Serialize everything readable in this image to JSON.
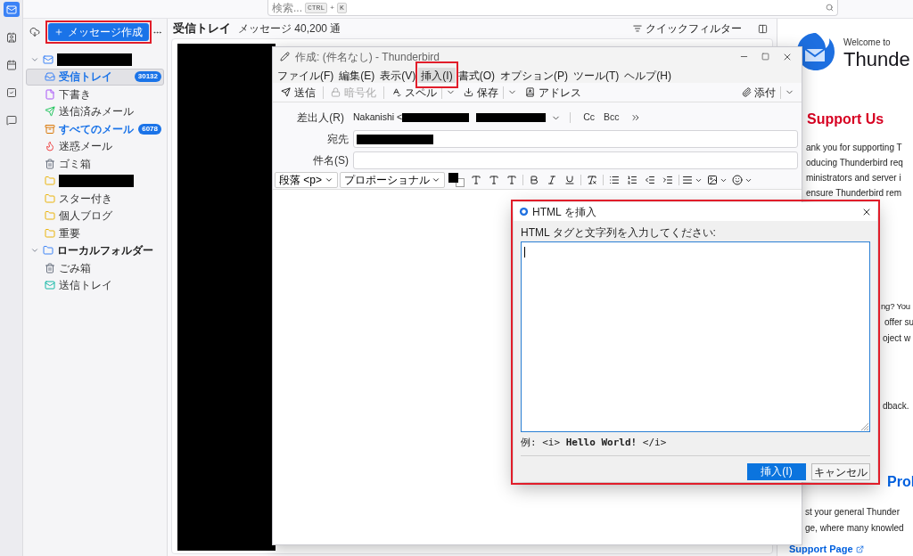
{
  "rail": [
    {
      "kind": "mail",
      "selected": true
    },
    {
      "kind": "contacts",
      "selected": false
    },
    {
      "kind": "calendar",
      "selected": false
    },
    {
      "kind": "tasks",
      "selected": false
    },
    {
      "kind": "chat",
      "selected": false
    }
  ],
  "search": {
    "placeholder": "検索...",
    "keys": [
      {
        "kind": "key",
        "label": "CTRL"
      },
      {
        "kind": "plus",
        "label": "+"
      },
      {
        "kind": "key",
        "label": "K"
      }
    ]
  },
  "folder_pane": {
    "compose_button": {
      "label": "メッセージ作成",
      "annotated": true
    },
    "folders": [
      {
        "kind": "account",
        "expanded": true,
        "selected": false,
        "children": [
          {
            "kind": "inbox",
            "label": "受信トレイ",
            "count": "30132",
            "unread": true,
            "selected": true
          },
          {
            "kind": "drafts",
            "label": "下書き",
            "unread": false,
            "selected": false
          },
          {
            "kind": "sent",
            "label": "送信済みメール",
            "unread": false,
            "selected": false
          },
          {
            "kind": "all",
            "label": "すべてのメール",
            "count": "6078",
            "unread": true,
            "selected": false
          },
          {
            "kind": "junk",
            "label": "迷惑メール",
            "unread": false,
            "selected": false
          },
          {
            "kind": "trash",
            "label": "ゴミ箱",
            "unread": false,
            "selected": false
          },
          {
            "kind": "folder",
            "unread": false,
            "selected": false
          },
          {
            "kind": "folder",
            "label": "スター付き",
            "unread": false,
            "selected": false
          },
          {
            "kind": "folder",
            "label": "個人ブログ",
            "unread": false,
            "selected": false
          },
          {
            "kind": "folder",
            "label": "重要",
            "unread": false,
            "selected": false
          }
        ]
      },
      {
        "kind": "local",
        "label": "ローカルフォルダー",
        "expanded": true,
        "selected": false,
        "children": [
          {
            "kind": "trash",
            "label": "ごみ箱",
            "unread": false,
            "selected": false
          },
          {
            "kind": "outbox",
            "label": "送信トレイ",
            "unread": false,
            "selected": false
          }
        ]
      }
    ]
  },
  "message_pane": {
    "title": "受信トレイ",
    "count": "メッセージ 40,200 通",
    "quick_filter": "クイックフィルター"
  },
  "start_page": {
    "welcome": "Welcome to",
    "brand": "Thunde",
    "lines": [
      {
        "kind": "alert-heading",
        "text": "Support Us"
      },
      {
        "kind": "text",
        "text": "ank you for supporting T"
      },
      {
        "kind": "text",
        "text": "oducing Thunderbird req"
      },
      {
        "kind": "text",
        "text": "ministrators and server i"
      },
      {
        "kind": "text",
        "text": "ensure Thunderbird rem"
      },
      {
        "kind": "text",
        "text": "ng? You"
      },
      {
        "kind": "text",
        "text": "offer su"
      },
      {
        "kind": "text",
        "text": "oject w"
      },
      {
        "kind": "text",
        "text": "dback."
      },
      {
        "kind": "heading",
        "text": "Prol"
      },
      {
        "kind": "text",
        "text": "st your general Thunder"
      },
      {
        "kind": "text",
        "text": "ge, where many knowled"
      },
      {
        "kind": "link",
        "text": "Support Page"
      }
    ]
  },
  "compose": {
    "title": "作成: (件名なし) - Thunderbird",
    "menu": [
      {
        "label": "ファイル(F)",
        "selected": false,
        "annotated": false
      },
      {
        "label": "編集(E)",
        "selected": false,
        "annotated": false
      },
      {
        "label": "表示(V)",
        "selected": false,
        "annotated": false
      },
      {
        "label": "挿入(I)",
        "selected": true,
        "annotated": true
      },
      {
        "label": "書式(O)",
        "selected": false,
        "annotated": false
      },
      {
        "label": "オプション(P)",
        "selected": false,
        "annotated": false
      },
      {
        "label": "ツール(T)",
        "selected": false,
        "annotated": false
      },
      {
        "label": "ヘルプ(H)",
        "selected": false,
        "annotated": false
      }
    ],
    "toolbar": [
      {
        "kind": "send",
        "label": "送信",
        "disabled": false
      },
      {
        "kind": "encrypt",
        "label": "暗号化",
        "disabled": true
      },
      {
        "kind": "spell",
        "label": "スペル",
        "disabled": false
      },
      {
        "kind": "dropdown",
        "disabled": false
      },
      {
        "kind": "save",
        "label": "保存",
        "disabled": false
      },
      {
        "kind": "dropdown",
        "disabled": false
      },
      {
        "kind": "address",
        "label": "アドレス",
        "disabled": false
      }
    ],
    "attach": "添付",
    "from": {
      "label": "差出人(R)",
      "value": "Nakanishi <"
    },
    "cc": "Cc",
    "bcc": "Bcc",
    "to": {
      "label": "宛先"
    },
    "subject": {
      "label": "件名(S)"
    },
    "format": {
      "paragraph": "段落 <p>",
      "font": "プロポーショナル"
    }
  },
  "dialog": {
    "title": "HTML を挿入",
    "prompt": "HTML タグと文字列を入力してください:",
    "focused": true,
    "example": "例: <i> **Hello World!** </i>",
    "annotated": true,
    "buttons": [
      {
        "kind": "primary",
        "label": "挿入(I)"
      },
      {
        "kind": "secondary",
        "label": "キャンセル"
      }
    ]
  }
}
